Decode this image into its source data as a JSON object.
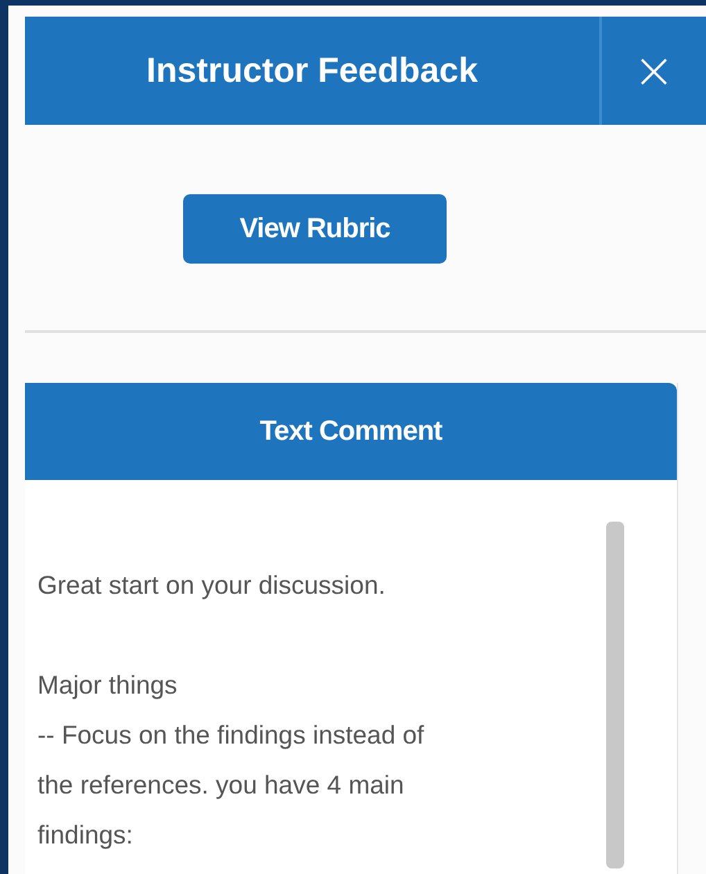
{
  "header": {
    "title": "Instructor Feedback",
    "close": "×"
  },
  "rubric_button": "View Rubric",
  "comment_card": {
    "title": "Text Comment",
    "paragraphs": [
      "Great start on your discussion.",
      "Major things\n-- Focus on the findings instead of\nthe references. you have 4 main\nfindings:"
    ]
  }
}
